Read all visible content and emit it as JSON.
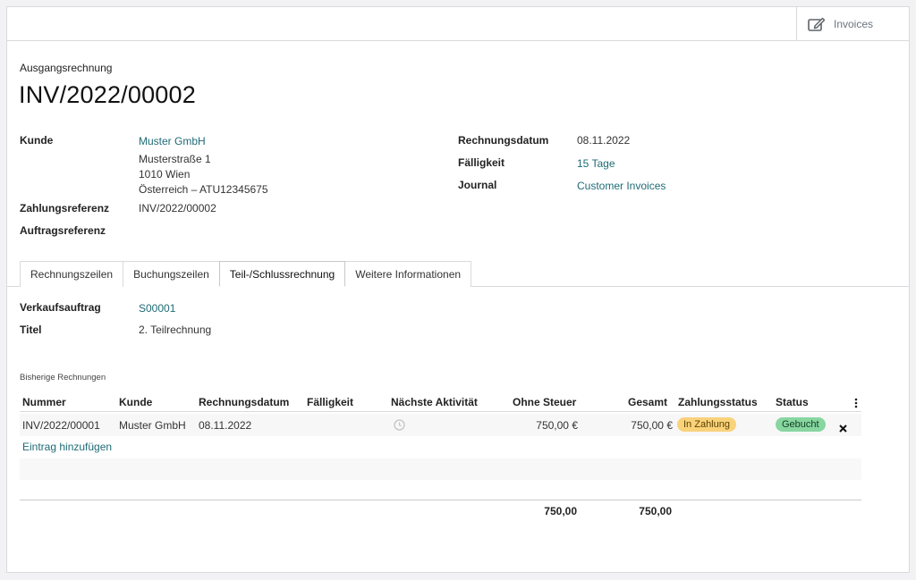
{
  "topbar": {
    "invoices_button": "Invoices"
  },
  "header": {
    "subtitle": "Ausgangsrechnung",
    "title": "INV/2022/00002"
  },
  "left_fields": {
    "kunde_label": "Kunde",
    "kunde_name": "Muster GmbH",
    "address_line1": "Musterstraße 1",
    "address_line2": "1010 Wien",
    "address_line3": "Österreich – ATU12345675",
    "zahlungsreferenz_label": "Zahlungsreferenz",
    "zahlungsreferenz_value": "INV/2022/00002",
    "auftragsreferenz_label": "Auftragsreferenz"
  },
  "right_fields": {
    "rechnungsdatum_label": "Rechnungsdatum",
    "rechnungsdatum_value": "08.11.2022",
    "faelligkeit_label": "Fälligkeit",
    "faelligkeit_value": "15 Tage",
    "journal_label": "Journal",
    "journal_value": "Customer Invoices"
  },
  "tabs": [
    "Rechnungszeilen",
    "Buchungszeilen",
    "Teil-/Schlussrechnung",
    "Weitere Informationen"
  ],
  "active_tab": "Teil-/Schlussrechnung",
  "tab_content": {
    "verkaufsauftrag_label": "Verkaufsauftrag",
    "verkaufsauftrag_value": "S00001",
    "titel_label": "Titel",
    "titel_value": "2. Teilrechnung"
  },
  "table": {
    "caption": "Bisherige Rechnungen",
    "columns": [
      "Nummer",
      "Kunde",
      "Rechnungsdatum",
      "Fälligkeit",
      "Nächste Aktivität",
      "Ohne Steuer",
      "Gesamt",
      "Zahlungsstatus",
      "Status"
    ],
    "rows": [
      {
        "nummer": "INV/2022/00001",
        "kunde": "Muster GmbH",
        "rechnungsdatum": "08.11.2022",
        "faelligkeit": "",
        "aktivitaet_icon": "clock-icon",
        "ohne_steuer": "750,00 €",
        "gesamt": "750,00 €",
        "zahlungsstatus": "In Zahlung",
        "status": "Gebucht"
      }
    ],
    "add_line": "Eintrag hinzufügen",
    "totals": {
      "ohne_steuer": "750,00",
      "gesamt": "750,00"
    }
  },
  "colors": {
    "link": "#1f6b75",
    "badge_in_zahlung": "#f9d27a",
    "badge_gebucht": "#88d6a0"
  }
}
